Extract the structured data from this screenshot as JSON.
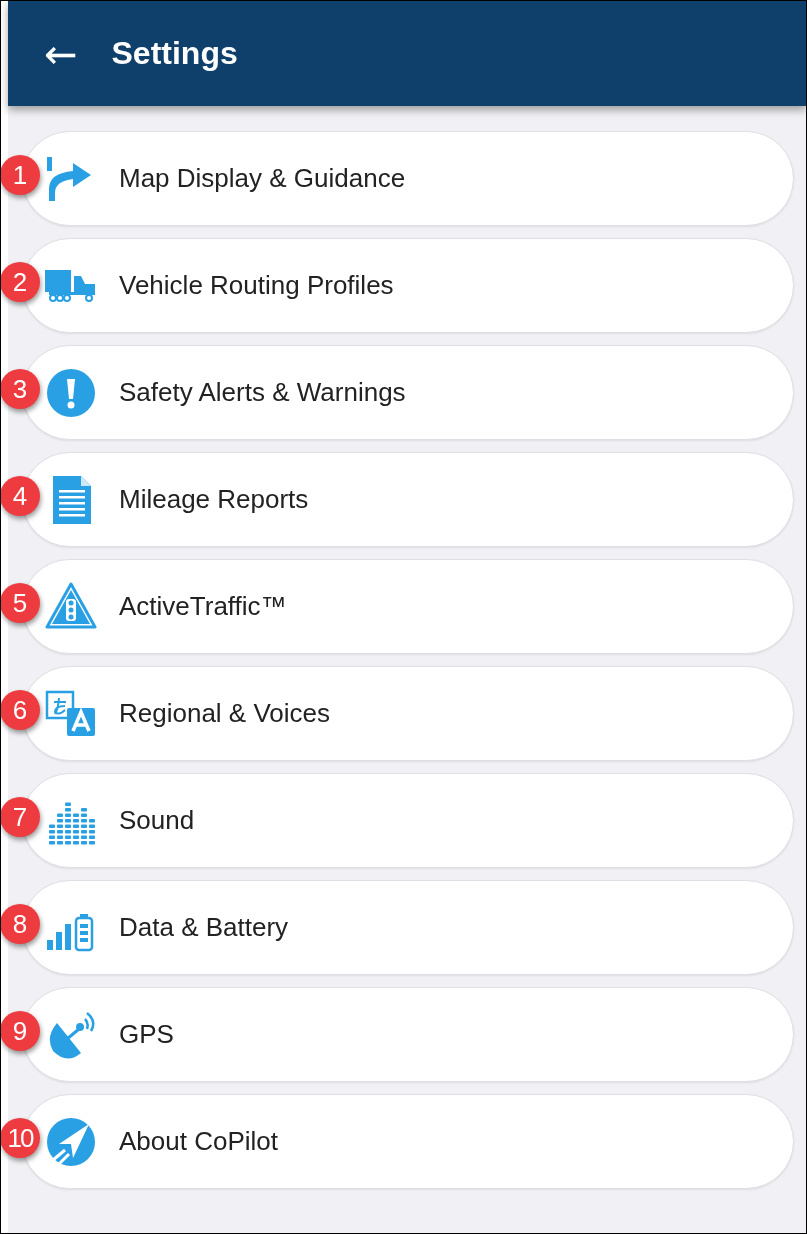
{
  "header": {
    "back": "←",
    "title": "Settings"
  },
  "items": [
    {
      "badge": "1",
      "label": "Map Display & Guidance"
    },
    {
      "badge": "2",
      "label": "Vehicle Routing Profiles"
    },
    {
      "badge": "3",
      "label": "Safety Alerts & Warnings"
    },
    {
      "badge": "4",
      "label": "Mileage Reports"
    },
    {
      "badge": "5",
      "label": "ActiveTraffic™"
    },
    {
      "badge": "6",
      "label": "Regional & Voices"
    },
    {
      "badge": "7",
      "label": "Sound"
    },
    {
      "badge": "8",
      "label": "Data & Battery"
    },
    {
      "badge": "9",
      "label": "GPS"
    },
    {
      "badge": "10",
      "label": "About CoPilot"
    }
  ]
}
